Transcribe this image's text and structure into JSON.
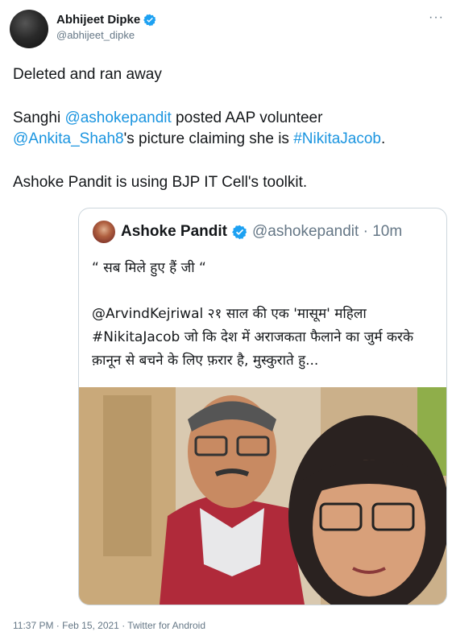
{
  "tweet": {
    "author_name": "Abhijeet Dipke",
    "author_handle": "@abhijeet_dipke",
    "line1": "Deleted and ran away",
    "p2_a": "Sanghi ",
    "p2_mention1": "@ashokepandit",
    "p2_b": " posted AAP volunteer",
    "p2_mention2": "@Ankita_Shah8",
    "p2_c": "'s picture claiming she is ",
    "p2_hashtag": "#NikitaJacob",
    "p2_d": ".",
    "line3": "Ashoke Pandit is using BJP IT Cell's toolkit.",
    "more_symbol": "···",
    "timestamp": "11:37 PM · Feb 15, 2021 · Twitter for Android"
  },
  "quoted": {
    "name": "Ashoke Pandit",
    "handle_time": "@ashokepandit · 10m",
    "line1": "“ सब मिले हुए हैं जी “",
    "para": "@ArvindKejriwal २१ साल की एक 'मासूम' महिला #NikitaJacob जो कि देश में अराजकता फैलाने का जुर्म करके क़ानून से बचने के लिए फ़रार है, मुस्कुराते हु..."
  },
  "colors": {
    "link": "#1b95e0",
    "verified": "#1da1f2",
    "secondary_text": "#657786",
    "border": "#ccd6dd"
  },
  "icons": [
    "verified-badge-icon",
    "more-options-icon"
  ]
}
